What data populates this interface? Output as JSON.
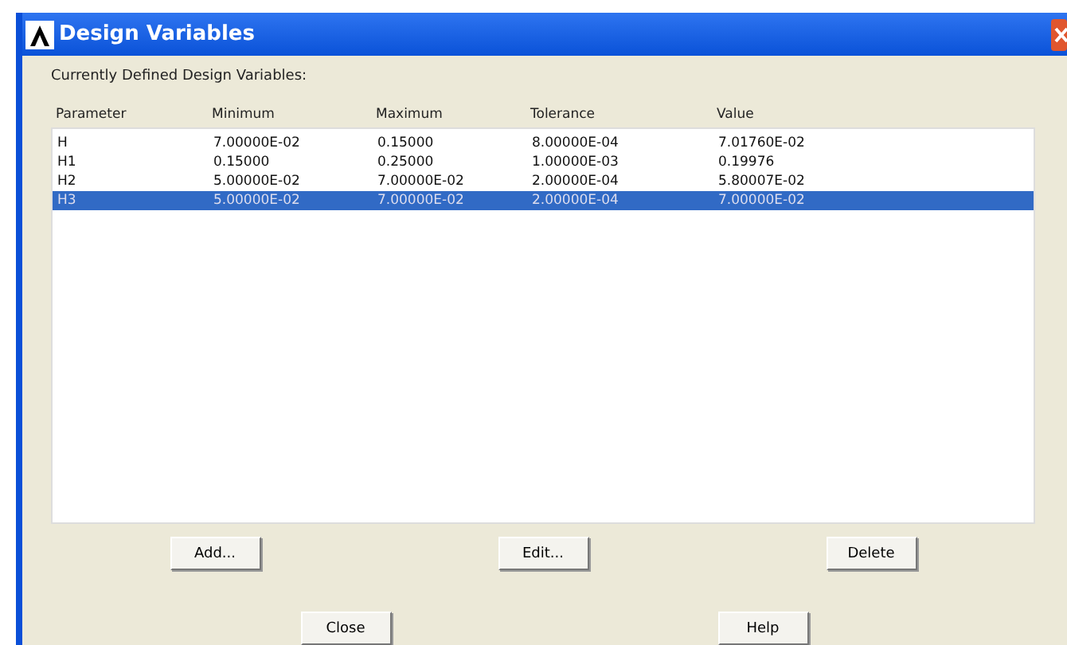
{
  "window": {
    "title": "Design Variables"
  },
  "list_label": "Currently Defined Design Variables:",
  "table": {
    "columns": [
      "Parameter",
      "Minimum",
      "Maximum",
      "Tolerance",
      "Value"
    ],
    "rows": [
      {
        "cells": [
          "H",
          "7.00000E-02",
          "0.15000",
          "8.00000E-04",
          "7.01760E-02"
        ],
        "selected": false
      },
      {
        "cells": [
          "H1",
          "0.15000",
          "0.25000",
          "1.00000E-03",
          "0.19976"
        ],
        "selected": false
      },
      {
        "cells": [
          "H2",
          "5.00000E-02",
          "7.00000E-02",
          "2.00000E-04",
          "5.80007E-02"
        ],
        "selected": false
      },
      {
        "cells": [
          "H3",
          "5.00000E-02",
          "7.00000E-02",
          "2.00000E-04",
          "7.00000E-02"
        ],
        "selected": true
      }
    ]
  },
  "list_buttons": [
    "Add...",
    "Edit...",
    "Delete"
  ],
  "dialog_buttons": [
    "Close",
    "Help"
  ]
}
